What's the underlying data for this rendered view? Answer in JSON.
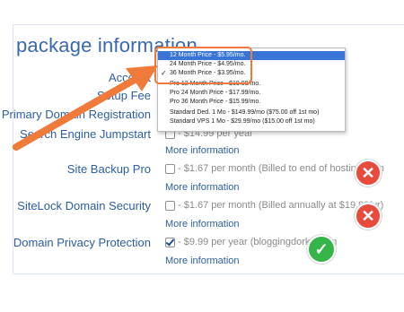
{
  "section_title": "package information",
  "rows": {
    "account": {
      "label": "Account"
    },
    "setup_fee": {
      "label": "Setup Fee"
    },
    "primary_domain": {
      "label": "Primary Domain Registration"
    },
    "seo": {
      "label": "Search Engine Jumpstart",
      "value": "- $14.99 per year",
      "more": "More information",
      "checked": false
    },
    "backup": {
      "label": "Site Backup Pro",
      "value": "- $1.67 per month (Billed to end of hosting term",
      "more": "More information",
      "checked": false,
      "badge": "x"
    },
    "sitelock": {
      "label": "SiteLock Domain Security",
      "value": "- $1.67 per month (Billed annually at $19.99/yr)",
      "more": "More information",
      "checked": false,
      "badge": "x"
    },
    "privacy": {
      "label": "Domain Privacy Protection",
      "value": "- $9.99 per year (bloggingdork2.com",
      "more": "More information",
      "checked": true,
      "badge": "check"
    }
  },
  "dropdown": {
    "options": [
      {
        "label": "12 Month Price - $5.95/mo.",
        "selected": true,
        "tick": false
      },
      {
        "label": "24 Month Price - $4.95/mo.",
        "selected": false,
        "tick": false
      },
      {
        "label": "36 Month Price - $3.95/mo.",
        "selected": false,
        "tick": true
      },
      {
        "label": "Pro 12 Month Price - $19.99/mo.",
        "selected": false,
        "tick": false
      },
      {
        "label": "Pro 24 Month Price - $17.99/mo.",
        "selected": false,
        "tick": false
      },
      {
        "label": "Pro 36 Month Price - $15.99/mo.",
        "selected": false,
        "tick": false
      },
      {
        "label": "Standard Ded. 1 Mo - $149.99/mo ($75.00 off 1st mo)",
        "selected": false,
        "tick": false
      },
      {
        "label": "Standard VPS 1 Mo - $29.99/mo ($15.00 off 1st mo)",
        "selected": false,
        "tick": false
      }
    ],
    "tick_glyph": "✓"
  },
  "badges": {
    "x_glyph": "✕",
    "check_glyph": "✓"
  },
  "colors": {
    "accent_arrow": "#f07a3a",
    "selected_option": "#3875d7",
    "x_badge": "#e84b3c",
    "check_badge": "#35b449"
  }
}
